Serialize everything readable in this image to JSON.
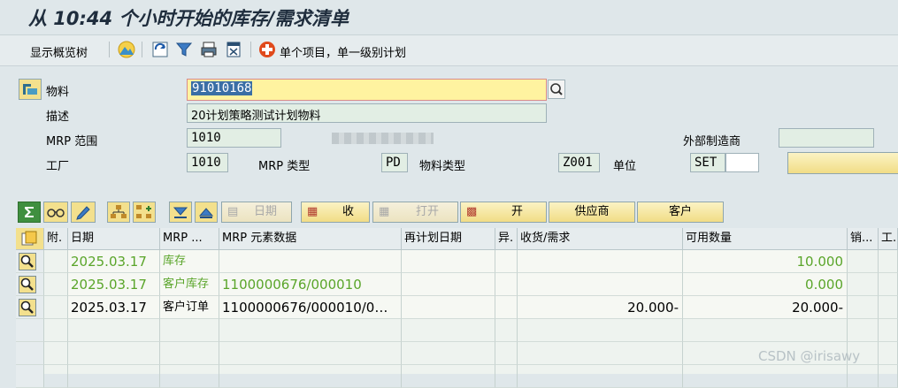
{
  "title": "从 10:44 个小时开始的库存/需求清单",
  "toolbar": {
    "show_overview_tree": "显示概览树",
    "single_item_label": "单个项目，单一级别计划",
    "icons": [
      "mountain-icon",
      "refresh-icon",
      "filter-icon",
      "print-icon",
      "document-icon",
      "stop-icon"
    ]
  },
  "header": {
    "material_label": "物料",
    "material_value": "91010168",
    "description_label": "描述",
    "description_value": "20计划策略测试计划物料",
    "mrp_area_label": "MRP 范围",
    "mrp_area_value": "1010",
    "plant_label": "工厂",
    "plant_value": "1010",
    "mrp_type_label": "MRP 类型",
    "mrp_type_value": "PD",
    "material_type_label": "物料类型",
    "material_type_value": "Z001",
    "unit_label": "单位",
    "unit_value": "SET",
    "ext_manufacturer_label": "外部制造商"
  },
  "grid_toolbar": {
    "date_label": "日期",
    "receive_label": "收",
    "open_label": "打开",
    "start_label": "开",
    "vendor_label": "供应商",
    "customer_label": "客户"
  },
  "table": {
    "columns": [
      "附.",
      "日期",
      "MRP ...",
      "MRP 元素数据",
      "再计划日期",
      "异.",
      "收货/需求",
      "可用数量",
      "销...",
      "工."
    ],
    "rows": [
      {
        "date": "2025.03.17",
        "element": "库存",
        "data": "",
        "reschedule": "",
        "exc": "",
        "receipt": "",
        "available": "10.000",
        "color": "#5aa52a"
      },
      {
        "date": "2025.03.17",
        "element": "客户库存",
        "data": "1100000676/000010",
        "reschedule": "",
        "exc": "",
        "receipt": "",
        "available": "0.000",
        "color": "#5aa52a"
      },
      {
        "date": "2025.03.17",
        "element": "客户订单",
        "data": "1100000676/000010/0…",
        "reschedule": "",
        "exc": "",
        "receipt": "20.000-",
        "available": "20.000-",
        "color": "#000000"
      }
    ]
  },
  "watermark": "CSDN @irisawy"
}
